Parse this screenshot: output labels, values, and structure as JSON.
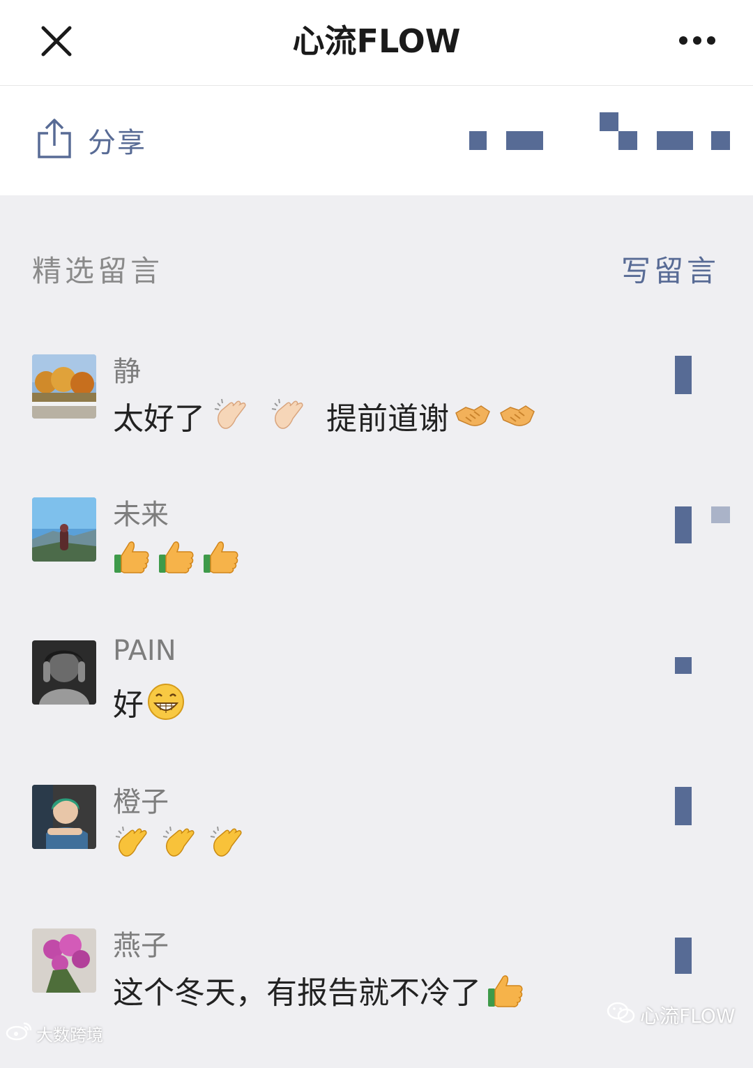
{
  "header": {
    "title": "心流FLOW",
    "close_icon": "close-icon",
    "more_icon": "more-dots-icon"
  },
  "share": {
    "label": "分享",
    "icon": "share-upload-icon"
  },
  "section": {
    "title": "精选留言",
    "write_label": "写留言"
  },
  "comments": [
    {
      "name": "静",
      "text_before": "太好了",
      "text_middle": "提前道谢",
      "text_after": "",
      "emojis_a": [
        "clap-light-icon",
        "clap-light-icon"
      ],
      "emojis_b": [
        "handshake-icon",
        "handshake-icon"
      ]
    },
    {
      "name": "未来",
      "text_before": "",
      "emojis_a": [
        "thumbs-up-icon",
        "thumbs-up-icon",
        "thumbs-up-icon"
      ]
    },
    {
      "name": "PAIN",
      "text_before": "好",
      "emojis_a": [
        "grin-icon"
      ]
    },
    {
      "name": "橙子",
      "text_before": "",
      "emojis_a": [
        "clap-icon",
        "clap-icon",
        "clap-icon"
      ]
    },
    {
      "name": "燕子",
      "text_before": "这个冬天，有报告就不冷了",
      "emojis_a": [
        "thumbs-up-icon"
      ]
    }
  ],
  "watermark": {
    "text": "心流FLOW",
    "icon": "wechat-icon"
  },
  "watermark2": {
    "text": "大数跨境",
    "icon": "weibo-icon"
  },
  "colors": {
    "accent": "#576b95",
    "background": "#efeff2",
    "header": "#ffffff"
  }
}
